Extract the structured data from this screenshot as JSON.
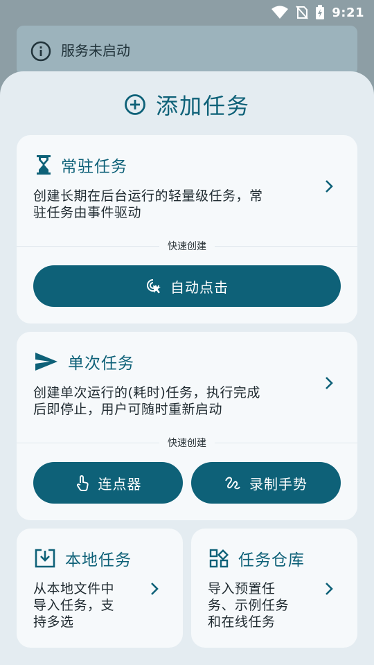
{
  "status_bar": {
    "time": "9:21",
    "icons": [
      "wifi-icon",
      "no-sim-icon",
      "battery-charging-icon"
    ]
  },
  "banner": {
    "icon": "info-icon",
    "text": "服务未启动"
  },
  "sheet": {
    "title": "添加任务",
    "title_icon": "add-circle-icon"
  },
  "resident_card": {
    "icon": "hourglass-icon",
    "title": "常驻任务",
    "desc_line1": "创建长期在后台运行的轻量级任务，常",
    "desc_line2": "驻任务由事件驱动",
    "quick_label": "快速创建",
    "buttons": [
      {
        "label": "自动点击",
        "icon": "tap-target-icon"
      }
    ]
  },
  "oneshot_card": {
    "icon": "send-icon",
    "title": "单次任务",
    "desc_line1": "创建单次运行的(耗时)任务，执行完成",
    "desc_line2": "后即停止，用户可随时重新启动",
    "quick_label": "快速创建",
    "buttons": [
      {
        "label": "连点器",
        "icon": "touch-icon"
      },
      {
        "label": "录制手势",
        "icon": "gesture-icon"
      }
    ]
  },
  "local_card": {
    "icon": "import-icon",
    "title": "本地任务",
    "desc_line1": "从本地文件中",
    "desc_line2": "导入任务，支",
    "desc_line3": "持多选"
  },
  "repo_card": {
    "icon": "grid-icon",
    "title": "任务仓库",
    "desc_line1": "导入预置任",
    "desc_line2": "务、示例任务",
    "desc_line3": "和在线任务"
  },
  "colors": {
    "accent": "#0e6178",
    "sheet_bg": "#e4ecf1",
    "card_bg": "#f6f9fb",
    "banner_bg": "#9cb3bc"
  }
}
